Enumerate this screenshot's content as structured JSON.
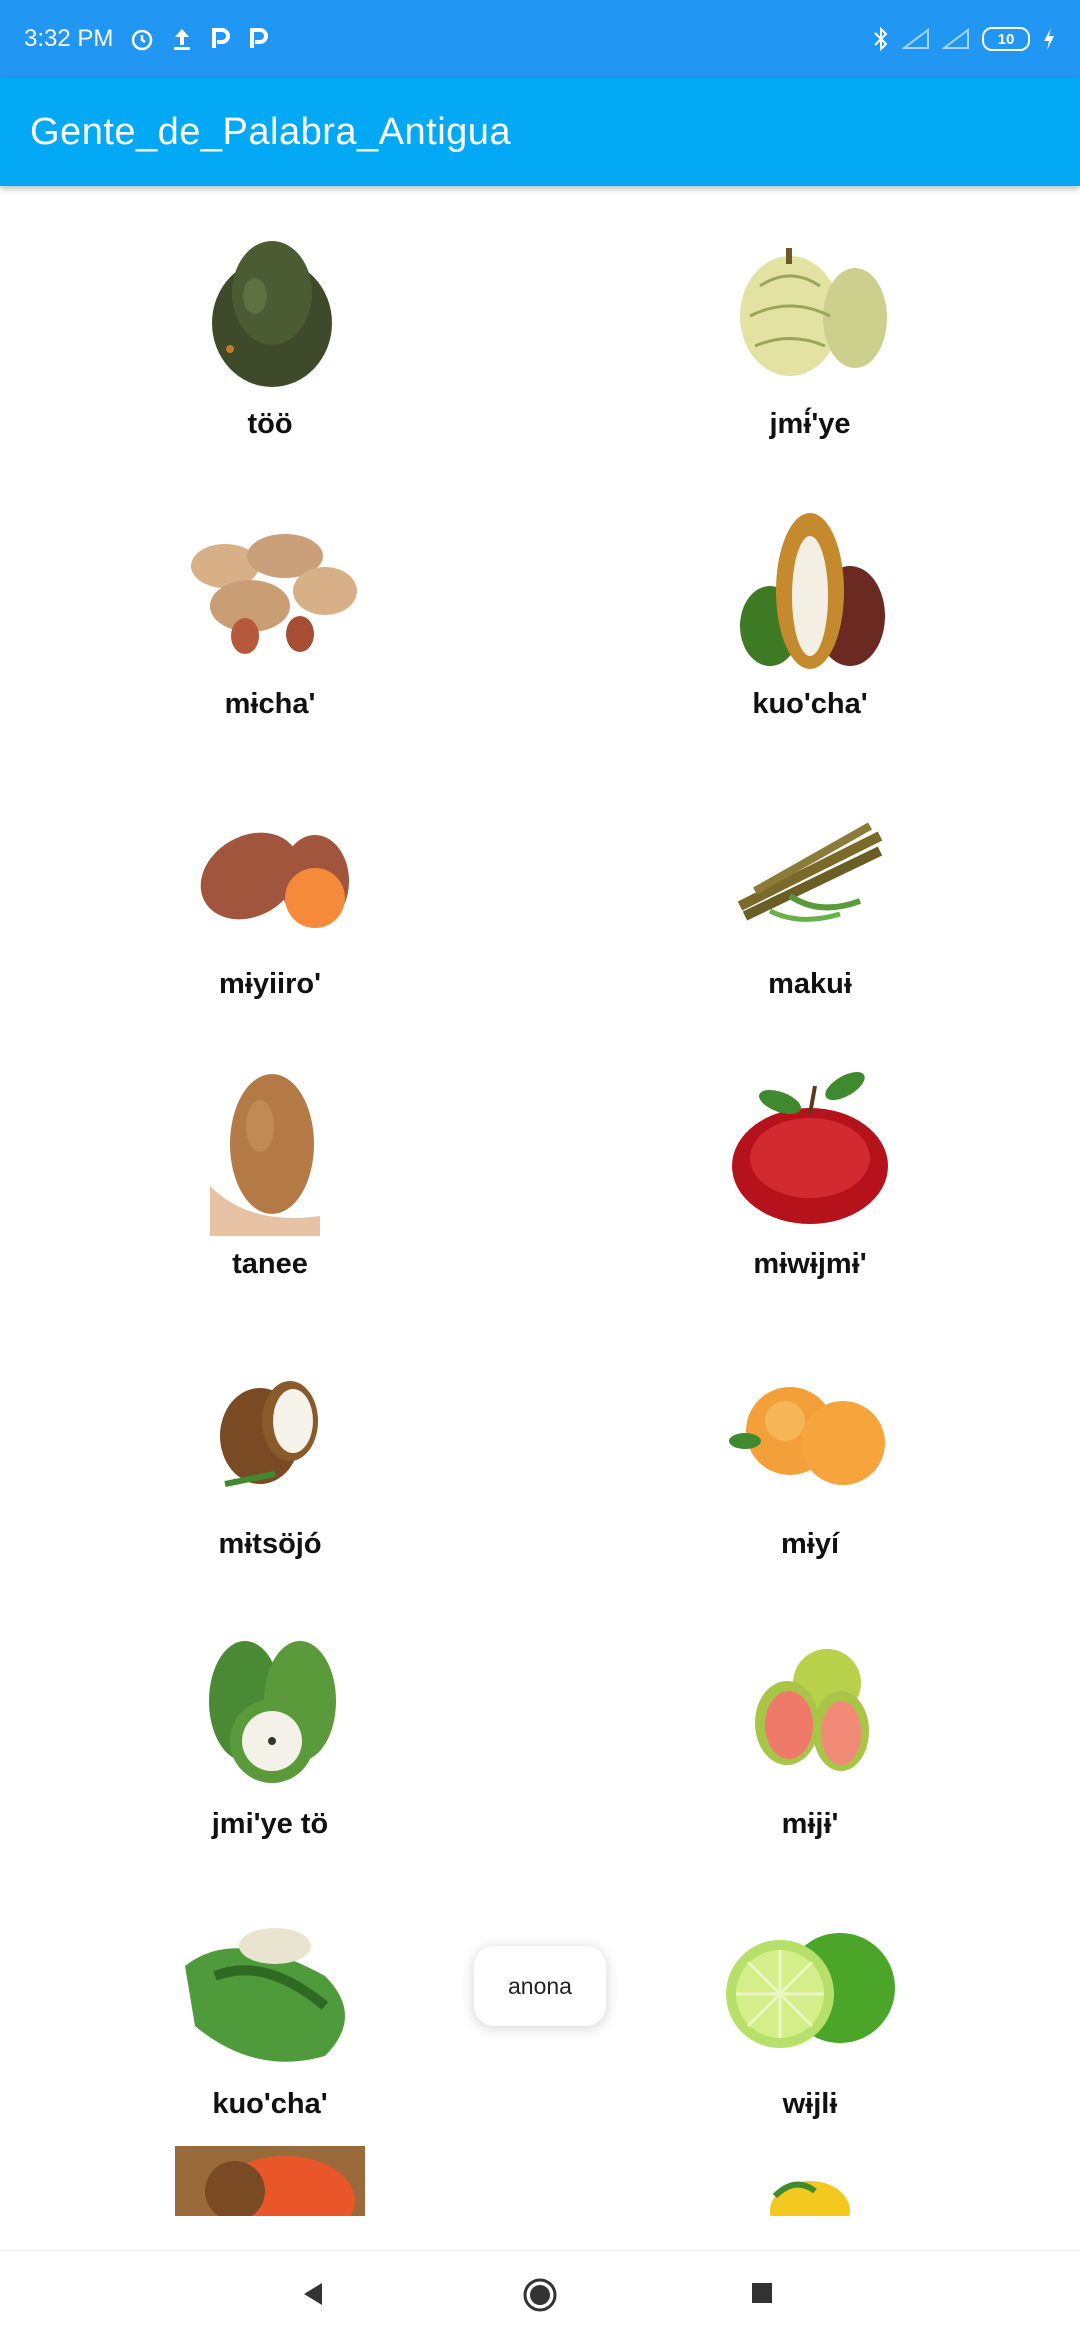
{
  "status_bar": {
    "time": "3:32 PM",
    "battery": "10",
    "icons": [
      "alarm-icon",
      "upload-icon",
      "p-icon",
      "p-icon",
      "bluetooth-icon",
      "signal-icon",
      "signal-icon",
      "charging-icon"
    ]
  },
  "app_bar": {
    "title": "Gente_de_Palabra_Antigua"
  },
  "items": [
    {
      "label": "töö",
      "icon": "avocado"
    },
    {
      "label": "jmɨ́'ye",
      "icon": "custard-apple"
    },
    {
      "label": "mɨcha'",
      "icon": "peanut"
    },
    {
      "label": "kuo'cha'",
      "icon": "cacao"
    },
    {
      "label": "mɨyiiro'",
      "icon": "sweet-potato"
    },
    {
      "label": "makuɨ",
      "icon": "sugarcane"
    },
    {
      "label": "tanee",
      "icon": "yam"
    },
    {
      "label": "mɨwɨjmɨ'",
      "icon": "apple"
    },
    {
      "label": "mɨtsöjó",
      "icon": "coconut"
    },
    {
      "label": "mɨyí",
      "icon": "peach"
    },
    {
      "label": "jmi'ye tö",
      "icon": "soursop"
    },
    {
      "label": "mɨjɨ'",
      "icon": "guava"
    },
    {
      "label": "kuo'cha'",
      "icon": "inga"
    },
    {
      "label": "wɨjlɨ",
      "icon": "lime"
    }
  ],
  "toast": {
    "text": "anona"
  },
  "nav": {
    "back": "back",
    "home": "home",
    "recents": "recents"
  },
  "colors": {
    "status": "#2196f3",
    "appbar": "#03a9f4"
  }
}
